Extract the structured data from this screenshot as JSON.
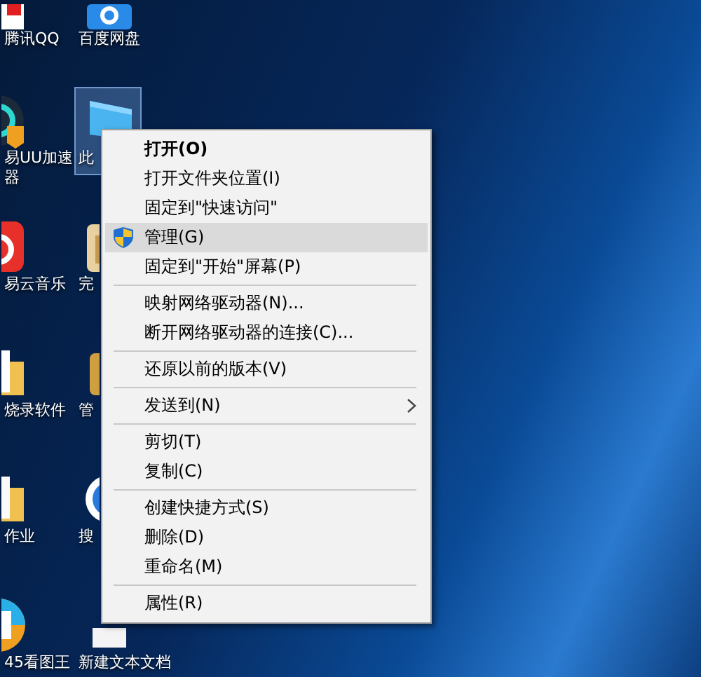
{
  "desktop_icons": [
    {
      "label": "腾讯QQ",
      "selected": false
    },
    {
      "label": "百度网盘",
      "selected": false
    },
    {
      "label": "易UU加速器",
      "selected": false
    },
    {
      "label": "此",
      "selected": true
    },
    {
      "label": "易云音乐",
      "selected": false
    },
    {
      "label": "完",
      "selected": false
    },
    {
      "label": "烧录软件",
      "selected": false
    },
    {
      "label": "管",
      "selected": false
    },
    {
      "label": "作业",
      "selected": false
    },
    {
      "label": "搜",
      "selected": false
    },
    {
      "label": "45看图王",
      "selected": false
    },
    {
      "label": "新建文本文档",
      "selected": false
    }
  ],
  "context_menu": {
    "items": [
      {
        "kind": "item",
        "label": "打开(O)",
        "default": true,
        "selected": false,
        "elevated": false,
        "submenu": false
      },
      {
        "kind": "item",
        "label": "打开文件夹位置(I)",
        "default": false,
        "selected": false,
        "elevated": false,
        "submenu": false
      },
      {
        "kind": "item",
        "label": "固定到\"快速访问\"",
        "default": false,
        "selected": false,
        "elevated": false,
        "submenu": false
      },
      {
        "kind": "item",
        "label": "管理(G)",
        "default": false,
        "selected": true,
        "elevated": true,
        "submenu": false
      },
      {
        "kind": "item",
        "label": "固定到\"开始\"屏幕(P)",
        "default": false,
        "selected": false,
        "elevated": false,
        "submenu": false
      },
      {
        "kind": "separator"
      },
      {
        "kind": "item",
        "label": "映射网络驱动器(N)...",
        "default": false,
        "selected": false,
        "elevated": false,
        "submenu": false
      },
      {
        "kind": "item",
        "label": "断开网络驱动器的连接(C)...",
        "default": false,
        "selected": false,
        "elevated": false,
        "submenu": false
      },
      {
        "kind": "separator"
      },
      {
        "kind": "item",
        "label": "还原以前的版本(V)",
        "default": false,
        "selected": false,
        "elevated": false,
        "submenu": false
      },
      {
        "kind": "separator"
      },
      {
        "kind": "item",
        "label": "发送到(N)",
        "default": false,
        "selected": false,
        "elevated": false,
        "submenu": true
      },
      {
        "kind": "separator"
      },
      {
        "kind": "item",
        "label": "剪切(T)",
        "default": false,
        "selected": false,
        "elevated": false,
        "submenu": false
      },
      {
        "kind": "item",
        "label": "复制(C)",
        "default": false,
        "selected": false,
        "elevated": false,
        "submenu": false
      },
      {
        "kind": "separator"
      },
      {
        "kind": "item",
        "label": "创建快捷方式(S)",
        "default": false,
        "selected": false,
        "elevated": false,
        "submenu": false
      },
      {
        "kind": "item",
        "label": "删除(D)",
        "default": false,
        "selected": false,
        "elevated": false,
        "submenu": false
      },
      {
        "kind": "item",
        "label": "重命名(M)",
        "default": false,
        "selected": false,
        "elevated": false,
        "submenu": false
      },
      {
        "kind": "separator"
      },
      {
        "kind": "item",
        "label": "属性(R)",
        "default": false,
        "selected": false,
        "elevated": false,
        "submenu": false
      }
    ]
  }
}
